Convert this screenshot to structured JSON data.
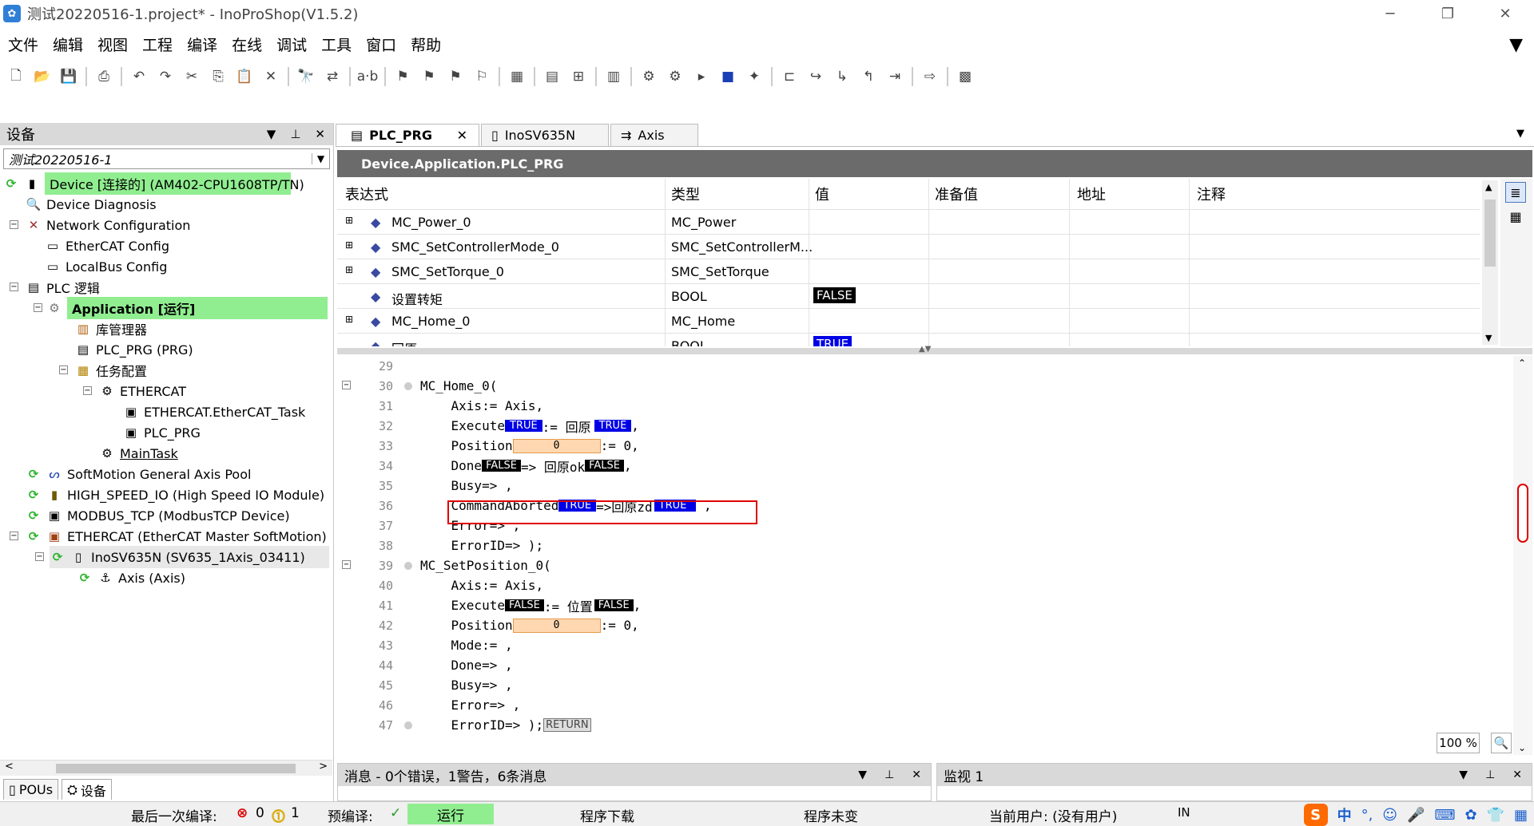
{
  "window": {
    "title": "测试20220516-1.project* - InoProShop(V1.5.2)",
    "buttons": [
      "─",
      "❐",
      "✕"
    ]
  },
  "menu": [
    "文件",
    "编辑",
    "视图",
    "工程",
    "编译",
    "在线",
    "调试",
    "工具",
    "窗口",
    "帮助"
  ],
  "toolbar_icons": [
    "new-icon",
    "open-icon",
    "save-icon",
    "print-icon",
    "undo-icon",
    "redo-icon",
    "cut-icon",
    "copy-icon",
    "paste-icon",
    "delete-icon",
    "find-icon",
    "replace-icon",
    "ab-icon",
    "bookmark-icon",
    "bookmark-next-icon",
    "bookmark-prev-icon",
    "bookmark-clear-icon",
    "build-icon",
    "device-icon",
    "add-object-icon",
    "grid-icon",
    "login-icon",
    "logout-icon",
    "start-icon",
    "stop-icon",
    "reset-icon",
    "breakpoint-icon",
    "step-over-icon",
    "step-into-icon",
    "step-out-icon",
    "cursor-icon",
    "sequence-icon",
    "write-icon"
  ],
  "left_panel": {
    "title": "设备",
    "project": "测试20220516-1",
    "tree": [
      {
        "label": "Device [连接的] (AM402-CPU1608TP/TN)",
        "highlight": true
      },
      {
        "label": "Device Diagnosis"
      },
      {
        "label": "Network Configuration"
      },
      {
        "label": "EtherCAT Config"
      },
      {
        "label": "LocalBus Config"
      },
      {
        "label": "PLC 逻辑"
      },
      {
        "label": "Application [运行]",
        "highlight": true
      },
      {
        "label": "库管理器"
      },
      {
        "label": "PLC_PRG (PRG)"
      },
      {
        "label": "任务配置"
      },
      {
        "label": "ETHERCAT"
      },
      {
        "label": "ETHERCAT.EtherCAT_Task"
      },
      {
        "label": "PLC_PRG"
      },
      {
        "label": "MainTask"
      },
      {
        "label": "SoftMotion General Axis Pool"
      },
      {
        "label": "HIGH_SPEED_IO (High Speed IO Module)"
      },
      {
        "label": "MODBUS_TCP (ModbusTCP Device)"
      },
      {
        "label": "ETHERCAT (EtherCAT Master SoftMotion)"
      },
      {
        "label": "InoSV635N (SV635_1Axis_03411)"
      },
      {
        "label": "Axis (Axis)"
      }
    ],
    "bottom_tabs": [
      "POUs",
      "设备"
    ]
  },
  "editor": {
    "tabs": [
      "PLC_PRG",
      "InoSV635N",
      "Axis"
    ],
    "path": "Device.Application.PLC_PRG",
    "watch_headers": [
      "表达式",
      "类型",
      "值",
      "准备值",
      "地址",
      "注释"
    ],
    "watch_rows": [
      {
        "expr": "MC_Power_0",
        "type": "MC_Power",
        "value": ""
      },
      {
        "expr": "SMC_SetControllerMode_0",
        "type": "SMC_SetControllerM...",
        "value": ""
      },
      {
        "expr": "SMC_SetTorque_0",
        "type": "SMC_SetTorque",
        "value": ""
      },
      {
        "expr": "设置转矩",
        "type": "BOOL",
        "value": "FALSE"
      },
      {
        "expr": "MC_Home_0",
        "type": "MC_Home",
        "value": ""
      },
      {
        "expr": "回原",
        "type": "BOOL",
        "value": "TRUE"
      }
    ],
    "code": {
      "l29": "29",
      "l30": "30",
      "l31": "31",
      "l32": "32",
      "l33": "33",
      "l34": "34",
      "l35": "35",
      "l36": "36",
      "l37": "37",
      "l38": "38",
      "l39": "39",
      "l40": "40",
      "l41": "41",
      "l42": "42",
      "l43": "43",
      "l44": "44",
      "l45": "45",
      "l46": "46",
      "l47": "47",
      "t30": "MC_Home_0(",
      "t31": "    Axis:= Axis,",
      "t32a": "    Execute",
      "t32b": ":= 回原",
      "t32c": ",",
      "t33a": "    Position",
      "t33b": ":= 0,",
      "t34a": "    Done",
      "t34b": "=> 回原ok",
      "t34c": ",",
      "t35": "    Busy=> ,",
      "t36a": "    CommandAborted",
      "t36b": "=>回原zd",
      "t36c": " ,",
      "t37": "    Error=> ,",
      "t38": "    ErrorID=> );",
      "t39": "MC_SetPosition_0(",
      "t40": "    Axis:= Axis,",
      "t41a": "    Execute",
      "t41b": ":= 位置",
      "t41c": ",",
      "t42a": "    Position",
      "t42b": ":= 0,",
      "t43": "    Mode:= ,",
      "t44": "    Done=> ,",
      "t45": "    Busy=> ,",
      "t46": "    Error=> ,",
      "t47": "    ErrorID=> );",
      "true": "TRUE",
      "false": "FALSE",
      "zero": "0",
      "ret": "RETURN"
    },
    "zoom": "100 %"
  },
  "messages_panel": {
    "title": "消息 - 0个错误，1警告，6条消息"
  },
  "watch_panel": {
    "title": "监视 1"
  },
  "status": {
    "last_compile": "最后一次编译:",
    "errors": "0",
    "warnings": "1",
    "precompile": "预编译:",
    "running": "运行",
    "download": "程序下载",
    "unchanged": "程序未变",
    "user": "当前用户: (没有用户)",
    "mode": "IN",
    "ime": "中"
  }
}
